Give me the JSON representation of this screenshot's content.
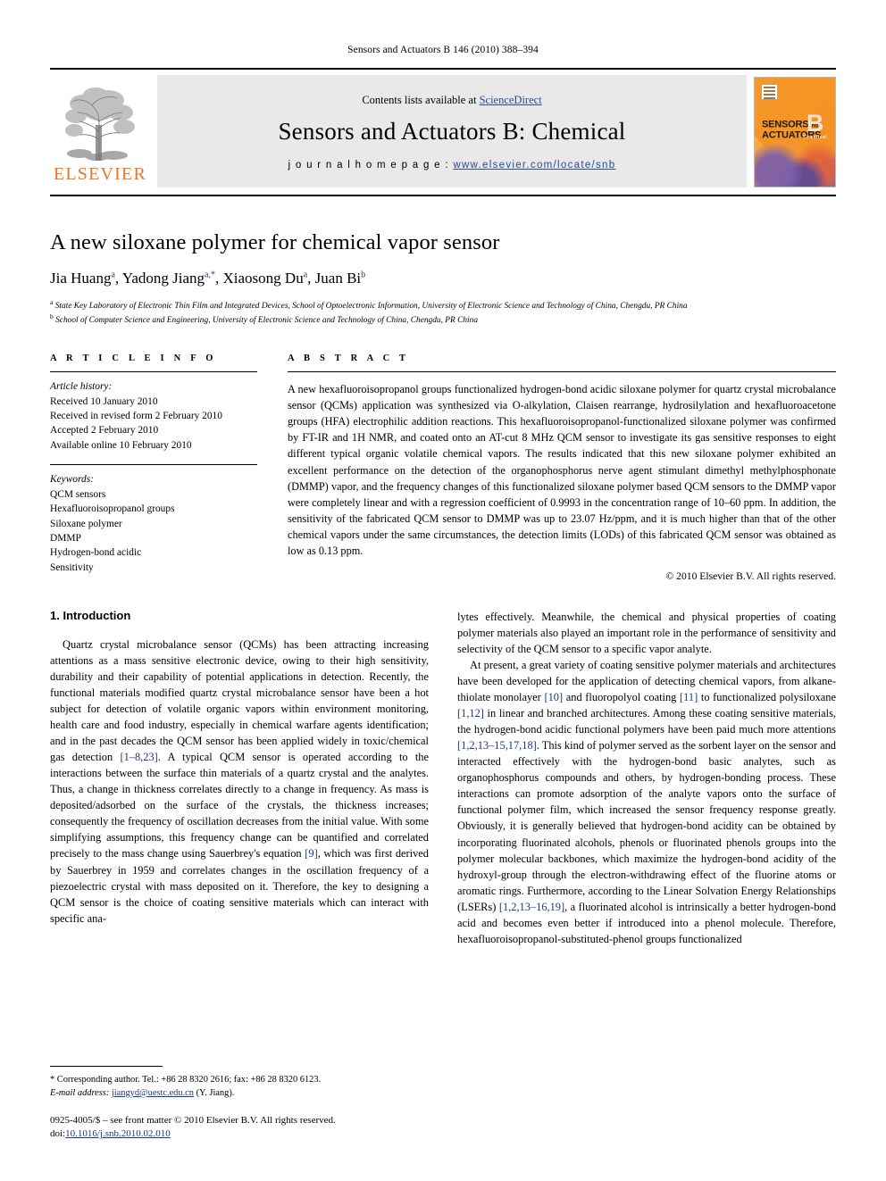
{
  "running_head": "Sensors and Actuators B 146 (2010) 388–394",
  "masthead": {
    "publisher_name": "ELSEVIER",
    "contents_prefix": "Contents lists available at ",
    "contents_link": "ScienceDirect",
    "journal_title": "Sensors and Actuators B: Chemical",
    "homepage_label": "j o u r n a l   h o m e p a g e :  ",
    "homepage_url": "www.elsevier.com/locate/snb",
    "cover": {
      "line1": "SENSORS",
      "line1_small": "and",
      "line2": "ACTUATORS",
      "letter": "B",
      "letter_sub": "Chemical"
    },
    "link_color": "#2a4b8d",
    "brand_color": "#E87722"
  },
  "article": {
    "title": "A new siloxane polymer for chemical vapor sensor",
    "authors_html": "Jia Huang<sup>a</sup>, Yadong Jiang<sup>a,*</sup>, Xiaosong Du<sup>a</sup>, Juan Bi<sup>b</sup>",
    "affiliation_a": "State Key Laboratory of Electronic Thin Film and Integrated Devices, School of Optoelectronic Information, University of Electronic Science and Technology of China, Chengdu, PR China",
    "affiliation_b": "School of Computer Science and Engineering, University of Electronic Science and Technology of China, Chengdu, PR China"
  },
  "article_info": {
    "heading": "A R T I C L E   I N F O",
    "history_title": "Article history:",
    "history": [
      "Received 10 January 2010",
      "Received in revised form 2 February 2010",
      "Accepted 2 February 2010",
      "Available online 10 February 2010"
    ],
    "keywords_title": "Keywords:",
    "keywords": [
      "QCM sensors",
      "Hexafluoroisopropanol groups",
      "Siloxane polymer",
      "DMMP",
      "Hydrogen-bond acidic",
      "Sensitivity"
    ]
  },
  "abstract": {
    "heading": "A B S T R A C T",
    "text": "A new hexafluoroisopropanol groups functionalized hydrogen-bond acidic siloxane polymer for quartz crystal microbalance sensor (QCMs) application was synthesized via O-alkylation, Claisen rearrange, hydrosilylation and hexafluoroacetone groups (HFA) electrophilic addition reactions. This hexafluoroisopropanol-functionalized siloxane polymer was confirmed by FT-IR and 1H NMR, and coated onto an AT-cut 8 MHz QCM sensor to investigate its gas sensitive responses to eight different typical organic volatile chemical vapors. The results indicated that this new siloxane polymer exhibited an excellent performance on the detection of the organophosphorus nerve agent stimulant dimethyl methylphosphonate (DMMP) vapor, and the frequency changes of this functionalized siloxane polymer based QCM sensors to the DMMP vapor were completely linear and with a regression coefficient of 0.9993 in the concentration range of 10–60 ppm. In addition, the sensitivity of the fabricated QCM sensor to DMMP was up to 23.07 Hz/ppm, and it is much higher than that of the other chemical vapors under the same circumstances, the detection limits (LODs) of this fabricated QCM sensor was obtained as low as 0.13 ppm.",
    "copyright": "© 2010 Elsevier B.V. All rights reserved."
  },
  "body": {
    "section_heading": "1.  Introduction",
    "left_p1": "Quartz crystal microbalance sensor (QCMs) has been attracting increasing attentions as a mass sensitive electronic device, owing to their high sensitivity, durability and their capability of potential applications in detection. Recently, the functional materials modified quartz crystal microbalance sensor have been a hot subject for detection of volatile organic vapors within environment monitoring, health care and food industry, especially in chemical warfare agents identification; and in the past decades the QCM sensor has been applied widely in toxic/chemical gas detection ",
    "left_ref1": "[1–8,23]",
    "left_p1b": ". A typical QCM sensor is operated according to the interactions between the surface thin materials of a quartz crystal and the analytes. Thus, a change in thickness correlates directly to a change in frequency. As mass is deposited/adsorbed on the surface of the crystals, the thickness increases; consequently the frequency of oscillation decreases from the initial value. With some simplifying assumptions, this frequency change can be quantified and correlated precisely to the mass change using Sauerbrey's equation ",
    "left_ref2": "[9]",
    "left_p1c": ", which was first derived by Sauerbrey in 1959 and correlates changes in the oscillation frequency of a piezoelectric crystal with mass deposited on it. Therefore, the key to designing a QCM sensor is the choice of coating sensitive materials which can interact with specific ana-",
    "right_p1": "lytes effectively. Meanwhile, the chemical and physical properties of coating polymer materials also played an important role in the performance of sensitivity and selectivity of the QCM sensor to a specific vapor analyte.",
    "right_p2a": "At present, a great variety of coating sensitive polymer materials and architectures have been developed for the application of detecting chemical vapors, from alkane-thiolate monolayer ",
    "right_ref1": "[10]",
    "right_p2b": " and fluoropolyol coating ",
    "right_ref2": "[11]",
    "right_p2c": " to functionalized polysiloxane ",
    "right_ref3": "[1,12]",
    "right_p2d": " in linear and branched architectures. Among these coating sensitive materials, the hydrogen-bond acidic functional polymers have been paid much more attentions ",
    "right_ref4": "[1,2,13–15,17,18]",
    "right_p2e": ". This kind of polymer served as the sorbent layer on the sensor and interacted effectively with the hydrogen-bond basic analytes, such as organophosphorus compounds and others, by hydrogen-bonding process. These interactions can promote adsorption of the analyte vapors onto the surface of functional polymer film, which increased the sensor frequency response greatly. Obviously, it is generally believed that hydrogen-bond acidity can be obtained by incorporating fluorinated alcohols, phenols or fluorinated phenols groups into the polymer molecular backbones, which maximize the hydrogen-bond acidity of the hydroxyl-group through the electron-withdrawing effect of the fluorine atoms or aromatic rings. Furthermore, according to the Linear Solvation Energy Relationships (LSERs) ",
    "right_ref5": "[1,2,13–16,19]",
    "right_p2f": ", a fluorinated alcohol is intrinsically a better hydrogen-bond acid and becomes even better if introduced into a phenol molecule. Therefore, hexafluoroisopropanol-substituted-phenol groups functionalized"
  },
  "footnote": {
    "corresponding": "* Corresponding author. Tel.: +86 28 8320 2616; fax: +86 28 8320 6123.",
    "email_label": "E-mail address:",
    "email": "jiangyd@uestc.edu.cn",
    "email_suffix": " (Y. Jiang).",
    "issn_line": "0925-4005/$ – see front matter © 2010 Elsevier B.V. All rights reserved.",
    "doi_label": "doi:",
    "doi_value": "10.1016/j.snb.2010.02.010"
  }
}
